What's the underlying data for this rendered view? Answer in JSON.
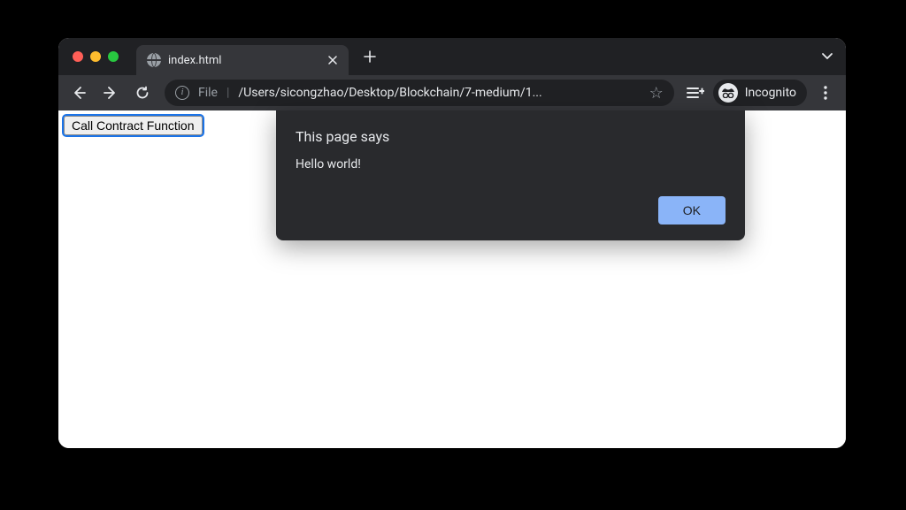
{
  "tab": {
    "title": "index.html"
  },
  "addressbar": {
    "file_label": "File",
    "url_path": "/Users/sicongzhao/Desktop/Blockchain/7-medium/1..."
  },
  "incognito": {
    "label": "Incognito"
  },
  "page": {
    "button_label": "Call Contract Function"
  },
  "alert": {
    "title": "This page says",
    "message": "Hello world!",
    "ok_label": "OK"
  }
}
